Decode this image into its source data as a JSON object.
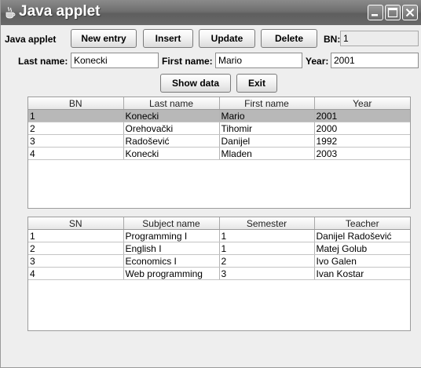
{
  "window": {
    "title": "Java applet"
  },
  "toolbar": {
    "app_label": "Java applet",
    "new_entry": "New entry",
    "insert": "Insert",
    "update": "Update",
    "delete": "Delete",
    "bn_label": "BN:",
    "bn_value": "1"
  },
  "form": {
    "last_name_label": "Last name:",
    "last_name_value": "Konecki",
    "first_name_label": "First name:",
    "first_name_value": "Mario",
    "year_label": "Year:",
    "year_value": "2001"
  },
  "actions": {
    "show_data": "Show data",
    "exit": "Exit"
  },
  "students_table": {
    "columns": [
      "BN",
      "Last name",
      "First name",
      "Year"
    ],
    "selected_row": 0,
    "rows": [
      [
        "1",
        "Konecki",
        "Mario",
        "2001"
      ],
      [
        "2",
        "Orehovački",
        "Tihomir",
        "2000"
      ],
      [
        "3",
        "Radošević",
        "Danijel",
        "1992"
      ],
      [
        "4",
        "Konecki",
        "Mladen",
        "2003"
      ]
    ]
  },
  "subjects_table": {
    "columns": [
      "SN",
      "Subject name",
      "Semester",
      "Teacher"
    ],
    "rows": [
      [
        "1",
        "Programming I",
        "1",
        "Danijel Radošević"
      ],
      [
        "2",
        "English I",
        "1",
        "Matej Golub"
      ],
      [
        "3",
        "Economics I",
        "2",
        "Ivo Galen"
      ],
      [
        "4",
        "Web programming",
        "3",
        "Ivan Kostar"
      ]
    ]
  }
}
